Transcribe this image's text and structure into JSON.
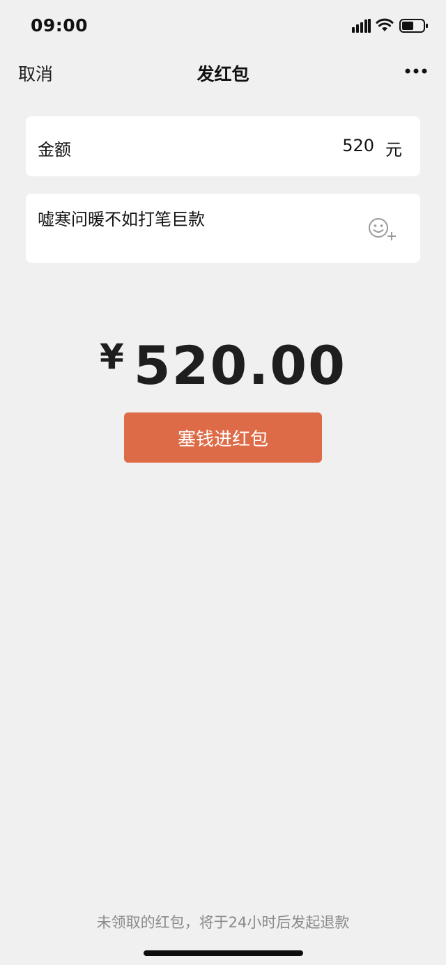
{
  "status_bar": {
    "time": "09:00",
    "icons": [
      "signal-icon",
      "wifi-icon",
      "battery-icon"
    ]
  },
  "nav": {
    "cancel_label": "取消",
    "title": "发红包",
    "more_icon": "more-icon"
  },
  "amount_field": {
    "label": "金额",
    "value": "520",
    "unit": "元"
  },
  "message_field": {
    "value": "嘘寒问暖不如打笔巨款",
    "emoji_icon": "emoji-add-icon"
  },
  "total": {
    "currency": "¥",
    "amount": "520.00"
  },
  "submit": {
    "label": "塞钱进红包",
    "color": "#dd6b47"
  },
  "footer": {
    "note": "未领取的红包，将于24小时后发起退款"
  },
  "colors": {
    "background": "#f0f0f0",
    "card": "#ffffff",
    "accent": "#dd6b47"
  }
}
